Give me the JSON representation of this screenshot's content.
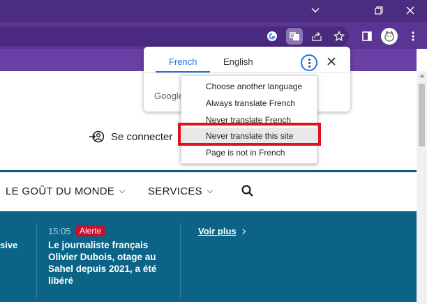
{
  "window_controls": {
    "dropdown_icon": "chevron-down-icon",
    "restore_icon": "restore-icon",
    "close_icon": "close-icon"
  },
  "toolbar": {
    "icons": [
      "google-icon",
      "translate-icon",
      "share-icon",
      "star-icon",
      "side-panel-icon",
      "profile-avatar"
    ]
  },
  "translate_popup": {
    "tabs": [
      {
        "label": "French",
        "active": true
      },
      {
        "label": "English",
        "active": false
      }
    ],
    "brand": "Google"
  },
  "options_menu": {
    "items": [
      {
        "label": "Choose another language"
      },
      {
        "label": "Always translate French"
      },
      {
        "label": "Never translate French"
      },
      {
        "label": "Never translate this site",
        "highlighted": true
      },
      {
        "label": "Page is not in French"
      }
    ]
  },
  "page": {
    "login_label": "Se connecter",
    "nav": [
      {
        "label": "LE GOÛT DU MONDE"
      },
      {
        "label": "SERVICES"
      }
    ],
    "news": {
      "left_fragment": "sive",
      "time": "15:05",
      "badge": "Alerte",
      "headline": "Le journaliste français Olivier Dubois, otage au Sahel depuis 2021, a été libéré",
      "more_label": "Voir plus"
    }
  },
  "colors": {
    "chrome_titlebar": "#4b2d7f",
    "chrome_toolbar": "#5a3592",
    "page_purple": "#6a3fa6",
    "news_blue": "#0b6486",
    "accent_blue": "#1a73e8",
    "alert_red": "#c8102e",
    "highlight_red": "#e0111b"
  }
}
